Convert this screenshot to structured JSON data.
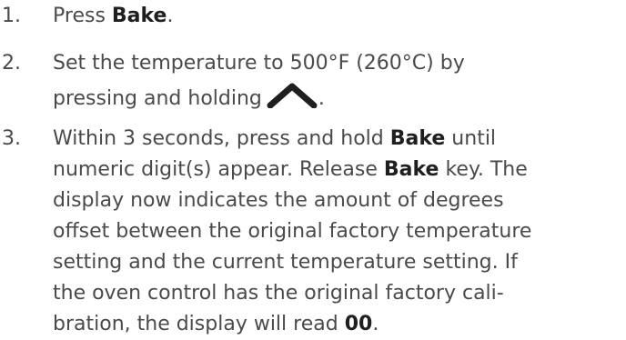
{
  "steps": [
    {
      "number": "1.",
      "prefix": "Press ",
      "bold": "Bake",
      "suffix": "."
    },
    {
      "number": "2.",
      "line1": "Set the temperature to 500°F (260°C) by",
      "line2_prefix": "pressing and holding",
      "icon": "up-arrow-icon",
      "line2_suffix": "."
    },
    {
      "number": "3.",
      "l1_prefix": "Within 3 seconds, press and hold ",
      "l1_bold": "Bake",
      "l1_suffix": " until",
      "l2_prefix": "numeric digit(s) appear. Release ",
      "l2_bold": "Bake",
      "l2_suffix": " key. The",
      "l3": "display now indicates the amount of degrees",
      "l4": "offset between the original factory temperature",
      "l5": "setting and the current temperature setting. If",
      "l6": "the oven control has the original factory cali-",
      "l7_prefix": "bration, the display will read ",
      "l7_bold": "00",
      "l7_suffix": "."
    }
  ]
}
